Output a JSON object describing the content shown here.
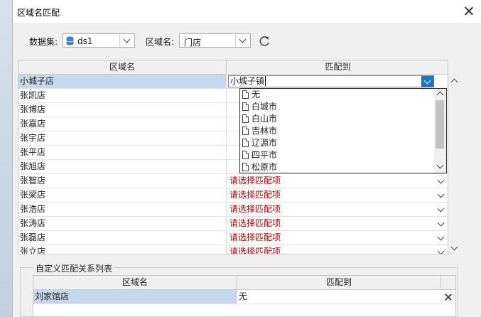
{
  "window": {
    "title": "区域名匹配"
  },
  "toolbar": {
    "dataset_label": "数据集:",
    "dataset_value": "ds1",
    "region_label": "区域名:",
    "region_value": "门店"
  },
  "grid": {
    "headers": [
      "区域名",
      "匹配到"
    ],
    "editing_value": "小城子镇",
    "rows": [
      {
        "name": "小城子店",
        "match": ""
      },
      {
        "name": "张凯店",
        "match": ""
      },
      {
        "name": "张博店",
        "match": ""
      },
      {
        "name": "张嘉店",
        "match": ""
      },
      {
        "name": "张宇店",
        "match": ""
      },
      {
        "name": "张平店",
        "match": ""
      },
      {
        "name": "张旭店",
        "match": ""
      },
      {
        "name": "张智店",
        "match": "请选择匹配项"
      },
      {
        "name": "张梁店",
        "match": "请选择匹配项"
      },
      {
        "name": "张浩店",
        "match": "请选择匹配项"
      },
      {
        "name": "张涛店",
        "match": "请选择匹配项"
      },
      {
        "name": "张磊店",
        "match": "请选择匹配项"
      },
      {
        "name": "张立店",
        "match": "请选择匹配项"
      }
    ]
  },
  "dropdown": {
    "options": [
      "无",
      "白城市",
      "白山市",
      "吉林市",
      "辽源市",
      "四平市",
      "松原市"
    ]
  },
  "custom": {
    "title": "自定义匹配关系列表",
    "headers": [
      "区域名",
      "匹配到"
    ],
    "rows": [
      {
        "name": "刘家馆店",
        "match": "无"
      }
    ]
  },
  "colors": {
    "accent": "#0f78d7",
    "placeholder_red": "#c00000",
    "selection": "#c5d9ee"
  }
}
